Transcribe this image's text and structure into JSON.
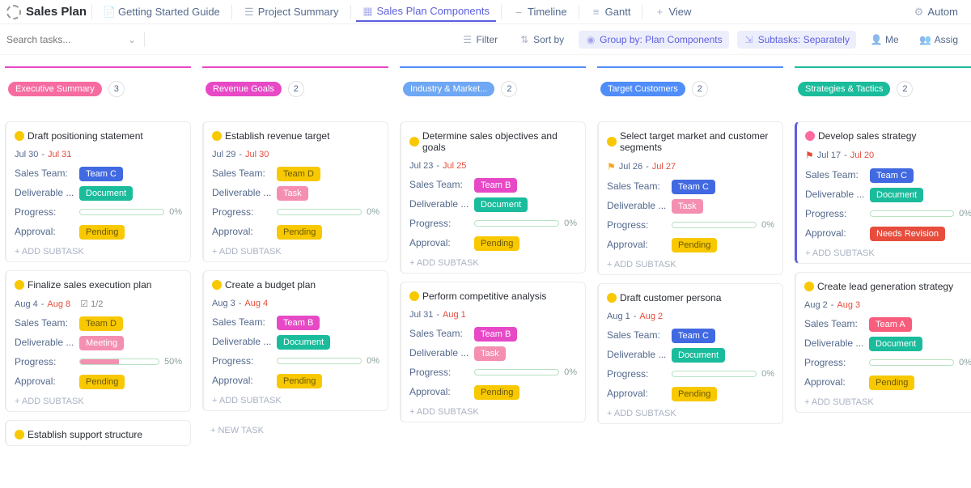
{
  "header": {
    "title": "Sales Plan",
    "tabs": [
      {
        "label": "Getting Started Guide",
        "icon": "doc"
      },
      {
        "label": "Project Summary",
        "icon": "list"
      },
      {
        "label": "Sales Plan Components",
        "icon": "board",
        "active": true
      },
      {
        "label": "Timeline",
        "icon": "timeline"
      },
      {
        "label": "Gantt",
        "icon": "gantt"
      },
      {
        "label": "View",
        "icon": "plus"
      }
    ],
    "right": {
      "automations": "Autom"
    }
  },
  "filterbar": {
    "search_placeholder": "Search tasks...",
    "filter": "Filter",
    "sort": "Sort by",
    "group": "Group by: Plan Components",
    "subtasks": "Subtasks: Separately",
    "me": "Me",
    "assignee": "Assig"
  },
  "columns": [
    {
      "name": "Executive Summary",
      "accent": "#e749c6",
      "pill_bg": "#f66ca0",
      "count": "3",
      "cards": [
        {
          "title": "Draft positioning statement",
          "status": "yellow",
          "date_start": "Jul 30",
          "date_end": "Jul 31",
          "team": {
            "label": "Team C",
            "cls": "team-c"
          },
          "deliverable": {
            "label": "Document",
            "cls": "deliv-doc"
          },
          "progress": "0",
          "approval": {
            "label": "Pending",
            "cls": "appr-pending"
          },
          "labels": {
            "team": "Sales Team:",
            "deliverable": "Deliverable ...",
            "progress": "Progress:",
            "approval": "Approval:"
          },
          "add_sub": "+ ADD SUBTASK"
        },
        {
          "title": "Finalize sales execution plan",
          "status": "yellow",
          "date_start": "Aug 4",
          "date_end": "Aug 8",
          "checklist": "1/2",
          "team": {
            "label": "Team D",
            "cls": "team-d"
          },
          "deliverable": {
            "label": "Meeting",
            "cls": "deliv-meet"
          },
          "progress": "50",
          "approval": {
            "label": "Pending",
            "cls": "appr-pending"
          },
          "labels": {
            "team": "Sales Team:",
            "deliverable": "Deliverable ...",
            "progress": "Progress:",
            "approval": "Approval:"
          },
          "add_sub": "+ ADD SUBTASK"
        },
        {
          "title": "Establish support structure",
          "status": "yellow",
          "stub": true
        }
      ]
    },
    {
      "name": "Revenue Goals",
      "accent": "#e749c6",
      "pill_bg": "#e749c6",
      "count": "2",
      "cards": [
        {
          "title": "Establish revenue target",
          "status": "yellow",
          "date_start": "Jul 29",
          "date_end": "Jul 30",
          "team": {
            "label": "Team D",
            "cls": "team-d"
          },
          "deliverable": {
            "label": "Task",
            "cls": "deliv-task"
          },
          "progress": "0",
          "approval": {
            "label": "Pending",
            "cls": "appr-pending"
          },
          "labels": {
            "team": "Sales Team:",
            "deliverable": "Deliverable ...",
            "progress": "Progress:",
            "approval": "Approval:"
          },
          "add_sub": "+ ADD SUBTASK"
        },
        {
          "title": "Create a budget plan",
          "status": "yellow",
          "date_start": "Aug 3",
          "date_end": "Aug 4",
          "team": {
            "label": "Team B",
            "cls": "team-b"
          },
          "deliverable": {
            "label": "Document",
            "cls": "deliv-doc"
          },
          "progress": "0",
          "approval": {
            "label": "Pending",
            "cls": "appr-pending"
          },
          "labels": {
            "team": "Sales Team:",
            "deliverable": "Deliverable ...",
            "progress": "Progress:",
            "approval": "Approval:"
          },
          "add_sub": "+ ADD SUBTASK"
        }
      ],
      "new_task": "+ NEW TASK"
    },
    {
      "name": "Industry & Market...",
      "accent": "#4f8df9",
      "pill_bg": "#6ea7f3",
      "count": "2",
      "cards": [
        {
          "title": "Determine sales objectives and goals",
          "status": "yellow",
          "date_start": "Jul 23",
          "date_end": "Jul 25",
          "team": {
            "label": "Team B",
            "cls": "team-b"
          },
          "deliverable": {
            "label": "Document",
            "cls": "deliv-doc"
          },
          "progress": "0",
          "approval": {
            "label": "Pending",
            "cls": "appr-pending"
          },
          "labels": {
            "team": "Sales Team:",
            "deliverable": "Deliverable ...",
            "progress": "Progress:",
            "approval": "Approval:"
          },
          "add_sub": "+ ADD SUBTASK"
        },
        {
          "title": "Perform competitive analysis",
          "status": "yellow",
          "date_start": "Jul 31",
          "date_end": "Aug 1",
          "team": {
            "label": "Team B",
            "cls": "team-b"
          },
          "deliverable": {
            "label": "Task",
            "cls": "deliv-task"
          },
          "progress": "0",
          "approval": {
            "label": "Pending",
            "cls": "appr-pending"
          },
          "labels": {
            "team": "Sales Team:",
            "deliverable": "Deliverable ...",
            "progress": "Progress:",
            "approval": "Approval:"
          },
          "add_sub": "+ ADD SUBTASK"
        }
      ]
    },
    {
      "name": "Target Customers",
      "accent": "#4f8df9",
      "pill_bg": "#4f8df9",
      "count": "2",
      "cards": [
        {
          "title": "Select target market and customer segments",
          "status": "yellow",
          "flag": "orange",
          "date_start": "Jul 26",
          "date_end": "Jul 27",
          "team": {
            "label": "Team C",
            "cls": "team-c"
          },
          "deliverable": {
            "label": "Task",
            "cls": "deliv-task"
          },
          "progress": "0",
          "approval": {
            "label": "Pending",
            "cls": "appr-pending"
          },
          "labels": {
            "team": "Sales Team:",
            "deliverable": "Deliverable ...",
            "progress": "Progress:",
            "approval": "Approval:"
          },
          "add_sub": "+ ADD SUBTASK"
        },
        {
          "title": "Draft customer persona",
          "status": "yellow",
          "date_start": "Aug 1",
          "date_end": "Aug 2",
          "team": {
            "label": "Team C",
            "cls": "team-c"
          },
          "deliverable": {
            "label": "Document",
            "cls": "deliv-doc"
          },
          "progress": "0",
          "approval": {
            "label": "Pending",
            "cls": "appr-pending"
          },
          "labels": {
            "team": "Sales Team:",
            "deliverable": "Deliverable ...",
            "progress": "Progress:",
            "approval": "Approval:"
          },
          "add_sub": "+ ADD SUBTASK"
        }
      ]
    },
    {
      "name": "Strategies & Tactics",
      "accent": "#1abc9c",
      "pill_bg": "#1abc9c",
      "count": "2",
      "cards": [
        {
          "title": "Develop sales strategy",
          "status": "pink",
          "flag": "red",
          "border_left": "#5b5fde",
          "date_start": "Jul 17",
          "date_end": "Jul 20",
          "team": {
            "label": "Team C",
            "cls": "team-c"
          },
          "deliverable": {
            "label": "Document",
            "cls": "deliv-doc"
          },
          "progress": "0",
          "approval": {
            "label": "Needs Revision",
            "cls": "appr-revision"
          },
          "labels": {
            "team": "Sales Team:",
            "deliverable": "Deliverable ...",
            "progress": "Progress:",
            "approval": "Approval:"
          },
          "add_sub": "+ ADD SUBTASK"
        },
        {
          "title": "Create lead generation strategy",
          "status": "yellow",
          "date_start": "Aug 2",
          "date_end": "Aug 3",
          "team": {
            "label": "Team A",
            "cls": "team-a"
          },
          "deliverable": {
            "label": "Document",
            "cls": "deliv-doc"
          },
          "progress": "0",
          "approval": {
            "label": "Pending",
            "cls": "appr-pending"
          },
          "labels": {
            "team": "Sales Team:",
            "deliverable": "Deliverable ...",
            "progress": "Progress:",
            "approval": "Approval:"
          },
          "add_sub": "+ ADD SUBTASK"
        }
      ]
    }
  ]
}
